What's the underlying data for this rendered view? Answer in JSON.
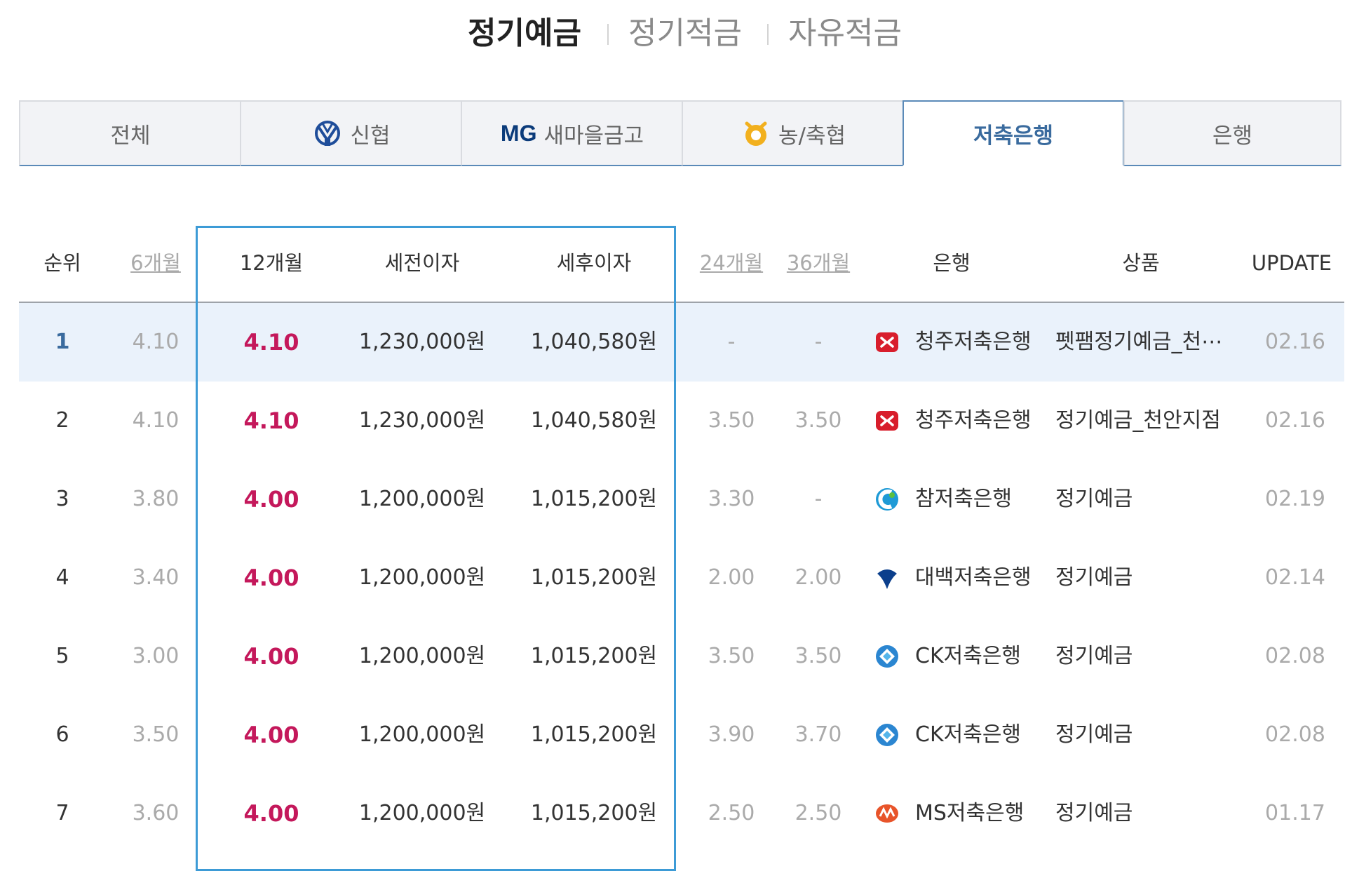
{
  "top_tabs": [
    {
      "label": "정기예금",
      "active": true
    },
    {
      "label": "정기적금",
      "active": false
    },
    {
      "label": "자유적금",
      "active": false
    }
  ],
  "category_tabs": [
    {
      "label": "전체",
      "icon": null,
      "active": false
    },
    {
      "label": "신협",
      "icon": "shinhyup-logo-icon",
      "active": false
    },
    {
      "label": "새마을금고",
      "logo_text": "MG",
      "icon": "mg-logo-icon",
      "active": false
    },
    {
      "label": "농/축협",
      "icon": "nonghyup-logo-icon",
      "active": false
    },
    {
      "label": "저축은행",
      "icon": null,
      "active": true
    },
    {
      "label": "은행",
      "icon": null,
      "active": false
    }
  ],
  "columns": {
    "rank": "순위",
    "m6": "6개월",
    "m12": "12개월",
    "pretax": "세전이자",
    "posttax": "세후이자",
    "m24": "24개월",
    "m36": "36개월",
    "bank": "은행",
    "product": "상품",
    "update": "UPDATE"
  },
  "rows": [
    {
      "rank": "1",
      "m6": "4.10",
      "m12": "4.10",
      "pretax": "1,230,000원",
      "posttax": "1,040,580원",
      "m24": "-",
      "m36": "-",
      "bank": "청주저축은행",
      "bank_icon": "cheongju-bank-icon",
      "product": "펫팸정기예금_천⋯",
      "update": "02.16"
    },
    {
      "rank": "2",
      "m6": "4.10",
      "m12": "4.10",
      "pretax": "1,230,000원",
      "posttax": "1,040,580원",
      "m24": "3.50",
      "m36": "3.50",
      "bank": "청주저축은행",
      "bank_icon": "cheongju-bank-icon",
      "product": "정기예금_천안지점",
      "update": "02.16"
    },
    {
      "rank": "3",
      "m6": "3.80",
      "m12": "4.00",
      "pretax": "1,200,000원",
      "posttax": "1,015,200원",
      "m24": "3.30",
      "m36": "-",
      "bank": "참저축은행",
      "bank_icon": "cham-bank-icon",
      "product": "정기예금",
      "update": "02.19"
    },
    {
      "rank": "4",
      "m6": "3.40",
      "m12": "4.00",
      "pretax": "1,200,000원",
      "posttax": "1,015,200원",
      "m24": "2.00",
      "m36": "2.00",
      "bank": "대백저축은행",
      "bank_icon": "daebaek-bank-icon",
      "product": "정기예금",
      "update": "02.14"
    },
    {
      "rank": "5",
      "m6": "3.00",
      "m12": "4.00",
      "pretax": "1,200,000원",
      "posttax": "1,015,200원",
      "m24": "3.50",
      "m36": "3.50",
      "bank": "CK저축은행",
      "bank_icon": "ck-bank-icon",
      "product": "정기예금",
      "update": "02.08"
    },
    {
      "rank": "6",
      "m6": "3.50",
      "m12": "4.00",
      "pretax": "1,200,000원",
      "posttax": "1,015,200원",
      "m24": "3.90",
      "m36": "3.70",
      "bank": "CK저축은행",
      "bank_icon": "ck-bank-icon",
      "product": "정기예금",
      "update": "02.08"
    },
    {
      "rank": "7",
      "m6": "3.60",
      "m12": "4.00",
      "pretax": "1,200,000원",
      "posttax": "1,015,200원",
      "m24": "2.50",
      "m36": "2.50",
      "bank": "MS저축은행",
      "bank_icon": "ms-bank-icon",
      "product": "정기예금",
      "update": "01.17"
    }
  ],
  "colors": {
    "rate_highlight": "#c4185b",
    "focus_border": "#3d9bd6",
    "active_tab": "#3a6b9e",
    "row_highlight_bg": "#eaf2fb"
  }
}
